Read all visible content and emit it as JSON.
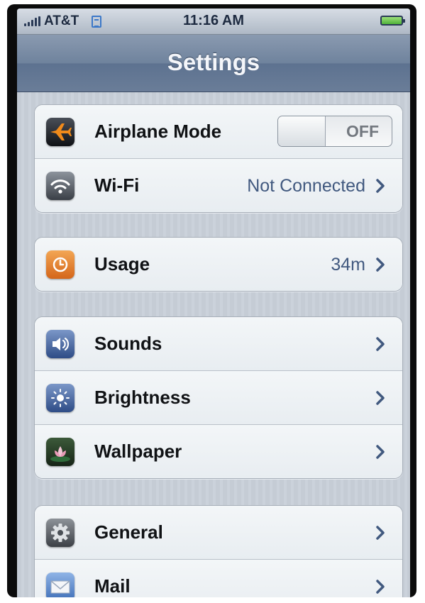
{
  "status_bar": {
    "carrier": "AT&T",
    "network_icon": "edge-icon",
    "time": "11:16 AM",
    "battery_icon": "battery-full-icon",
    "battery_color": "#4fb23a"
  },
  "nav": {
    "title": "Settings"
  },
  "groups": [
    {
      "rows": [
        {
          "icon": "airplane-icon",
          "label": "Airplane Mode",
          "toggle": "OFF"
        },
        {
          "icon": "wifi-icon",
          "label": "Wi-Fi",
          "value": "Not Connected"
        }
      ]
    },
    {
      "rows": [
        {
          "icon": "clock-icon",
          "label": "Usage",
          "value": "34m"
        }
      ]
    },
    {
      "rows": [
        {
          "icon": "speaker-icon",
          "label": "Sounds"
        },
        {
          "icon": "sun-icon",
          "label": "Brightness"
        },
        {
          "icon": "flower-icon",
          "label": "Wallpaper"
        }
      ]
    },
    {
      "rows": [
        {
          "icon": "gear-icon",
          "label": "General"
        },
        {
          "icon": "envelope-icon",
          "label": "Mail"
        }
      ]
    }
  ],
  "colors": {
    "navbar": "#6f839d",
    "value_text": "#41597f",
    "usage_icon": "#e57d2b"
  }
}
